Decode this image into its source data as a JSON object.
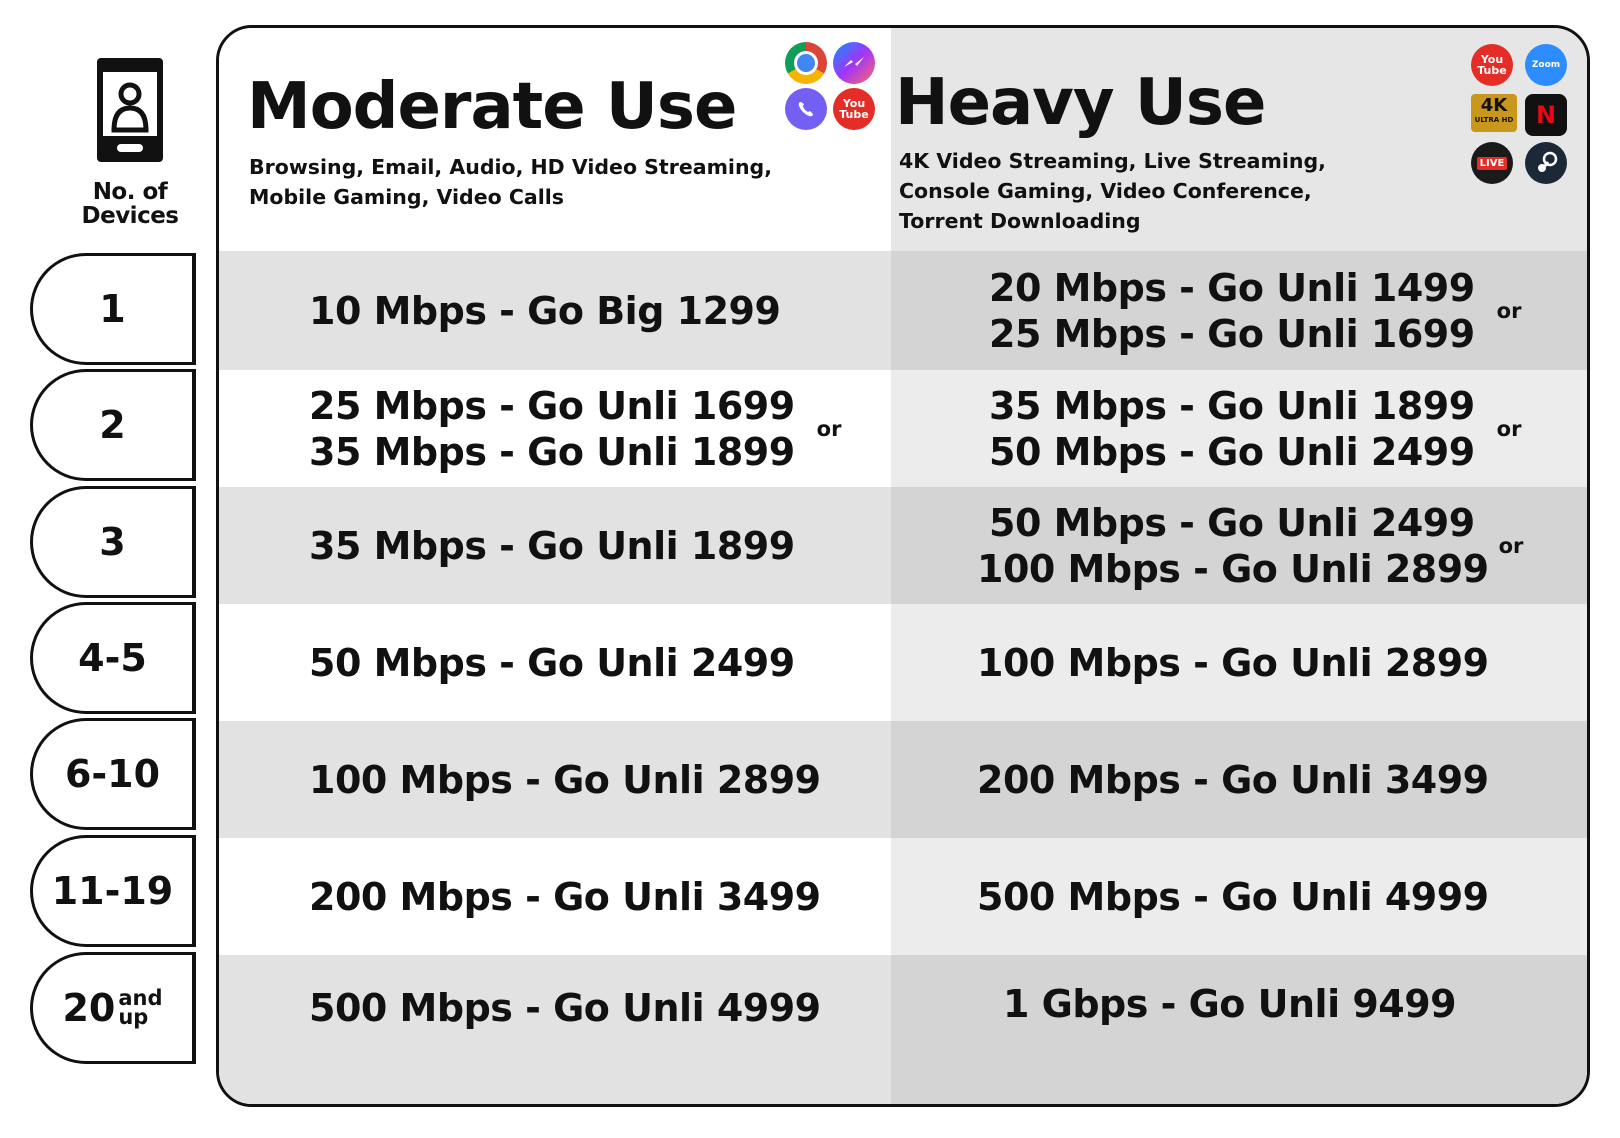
{
  "devices_label_line1": "No. of",
  "devices_label_line2": "Devices",
  "moderate": {
    "title": "Moderate Use",
    "subtitle_line1": "Browsing, Email, Audio, HD Video Streaming,",
    "subtitle_line2": "Mobile Gaming, Video Calls",
    "icons": [
      "chrome-icon",
      "messenger-icon",
      "viber-icon",
      "youtube-icon"
    ],
    "youtube_icon_text": "You\nTube"
  },
  "heavy": {
    "title": "Heavy Use",
    "subtitle_line1": "4K Video Streaming, Live Streaming,",
    "subtitle_line2": "Console Gaming, Video Conference,",
    "subtitle_line3": "Torrent Downloading",
    "icons": [
      "youtube-icon",
      "zoom-icon",
      "4k-ultrahd-icon",
      "netflix-icon",
      "live-icon",
      "steam-icon"
    ],
    "youtube_icon_text": "You\nTube",
    "zoom_icon_text": "Zoom",
    "uhd_icon_text": "4K",
    "uhd_icon_sub": "ULTRA HD",
    "netflix_icon_text": "N",
    "live_icon_text": "LIVE"
  },
  "or_label": "or",
  "rows": [
    {
      "devices": "1",
      "devices_suffix": "",
      "moderate": [
        "10 Mbps - Go Big 1299"
      ],
      "heavy": [
        "20 Mbps - Go Unli 1499",
        "25 Mbps - Go Unli 1699"
      ]
    },
    {
      "devices": "2",
      "devices_suffix": "",
      "moderate": [
        "25 Mbps - Go Unli 1699",
        "35 Mbps - Go Unli 1899"
      ],
      "heavy": [
        "35 Mbps - Go Unli 1899",
        "50 Mbps - Go Unli 2499"
      ]
    },
    {
      "devices": "3",
      "devices_suffix": "",
      "moderate": [
        "35 Mbps - Go Unli 1899"
      ],
      "heavy": [
        "50 Mbps - Go Unli 2499",
        "100 Mbps - Go Unli 2899"
      ]
    },
    {
      "devices": "4-5",
      "devices_suffix": "",
      "moderate": [
        "50 Mbps - Go Unli 2499"
      ],
      "heavy": [
        "100 Mbps - Go Unli 2899"
      ]
    },
    {
      "devices": "6-10",
      "devices_suffix": "",
      "moderate": [
        "100 Mbps - Go Unli 2899"
      ],
      "heavy": [
        "200 Mbps - Go Unli 3499"
      ]
    },
    {
      "devices": "11-19",
      "devices_suffix": "",
      "moderate": [
        "200 Mbps - Go Unli 3499"
      ],
      "heavy": [
        "500 Mbps - Go Unli 4999"
      ]
    },
    {
      "devices": "20",
      "devices_suffix": "and up",
      "moderate": [
        "500 Mbps - Go Unli 4999"
      ],
      "heavy": [
        "1 Gbps - Go Unli 9499"
      ]
    }
  ],
  "colors": {
    "outline": "#111111",
    "left_header_bg": "#ffffff",
    "right_header_bg": "#e6e6e6",
    "left_odd_bg": "#e2e2e2",
    "left_even_bg": "#ffffff",
    "right_odd_bg": "#d4d4d4",
    "right_even_bg": "#ececec",
    "youtube_red": "#e52d27",
    "zoom_blue": "#2d8cff"
  }
}
